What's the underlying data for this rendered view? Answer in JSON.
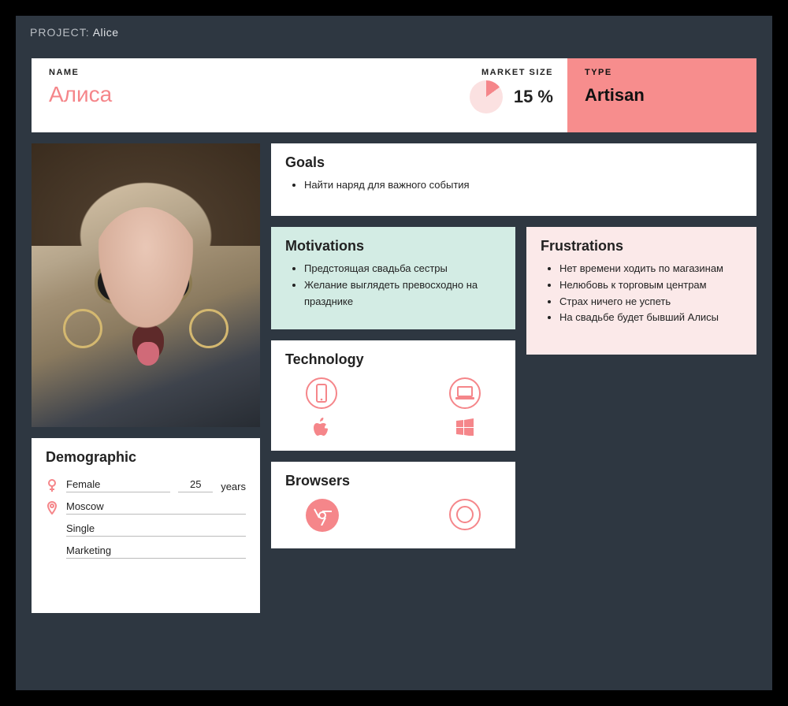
{
  "project": {
    "label": "PROJECT:",
    "value": "Alice"
  },
  "header": {
    "name_label": "NAME",
    "name_value": "Алиса",
    "market_label": "MARKET SIZE",
    "market_value": "15 %",
    "market_percent": 15,
    "type_label": "TYPE",
    "type_value": "Artisan"
  },
  "goals": {
    "title": "Goals",
    "items": [
      "Найти наряд для важного события"
    ]
  },
  "motivations": {
    "title": "Motivations",
    "items": [
      "Предстоящая свадьба сестры",
      "Желание выглядеть превосходно на празднике"
    ]
  },
  "frustrations": {
    "title": "Frustrations",
    "items": [
      "Нет времени ходить по магазинам",
      "Нелюбовь к торговым центрам",
      "Страх ничего не успеть",
      "На свадьбе будет бывший Алисы"
    ]
  },
  "technology": {
    "title": "Technology",
    "devices": [
      "phone",
      "laptop"
    ],
    "os": [
      "apple",
      "windows"
    ]
  },
  "browsers": {
    "title": "Browsers",
    "items": [
      "chrome",
      "safari"
    ]
  },
  "demographic": {
    "title": "Demographic",
    "gender": "Female",
    "age": "25",
    "age_unit": "years",
    "location": "Moscow",
    "status": "Single",
    "occupation": "Marketing"
  },
  "colors": {
    "accent": "#f5868a",
    "bg": "#2e3741"
  }
}
